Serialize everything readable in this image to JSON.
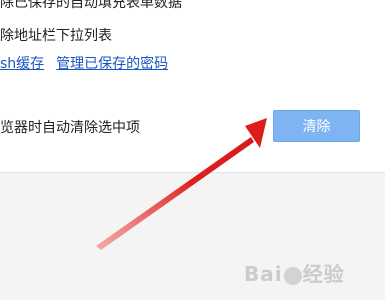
{
  "settings": {
    "line_autofill": "除已保存的自动填充表单数据",
    "line_addressbar": "除地址栏下拉列表",
    "links": {
      "flash_cache": "sh缓存",
      "manage_passwords": "管理已保存的密码"
    },
    "line_autoclear": "览器时自动清除选中项",
    "clear_button": "清除"
  },
  "watermark": {
    "text_left": "Bai",
    "text_right": "经验"
  },
  "colors": {
    "link": "#1a55c4",
    "button_bg": "#7fb4f3",
    "arrow": "#e02020"
  }
}
